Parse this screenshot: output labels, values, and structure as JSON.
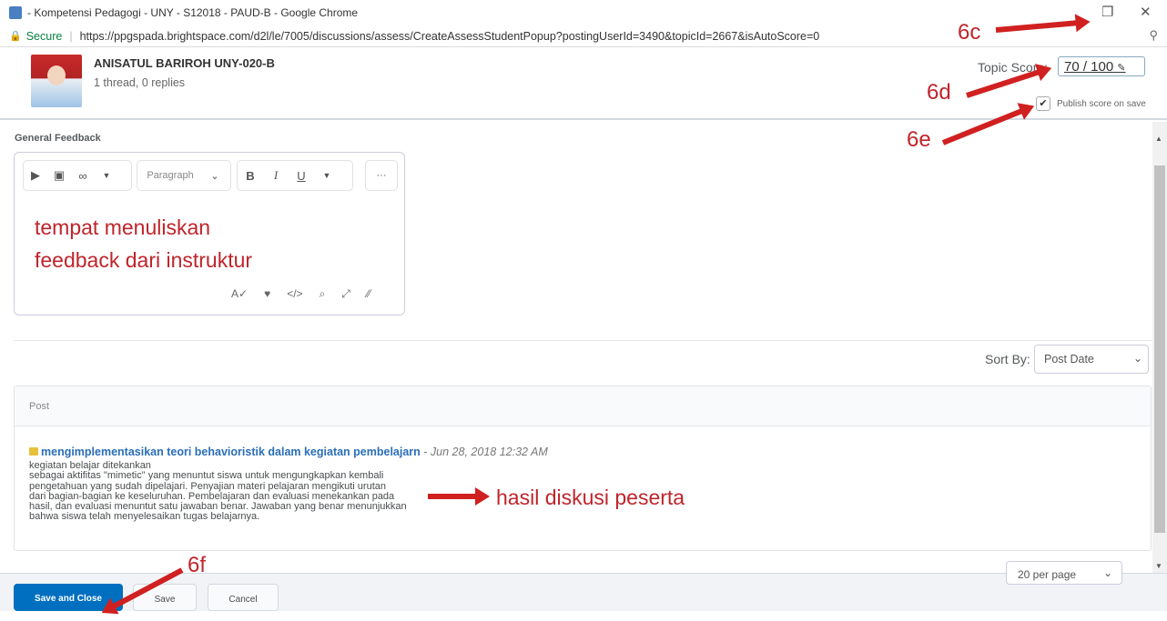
{
  "window": {
    "title": "- Kompetensi Pedagogi - UNY - S12018 - PAUD-B - Google Chrome",
    "restore_icon": "restore-icon",
    "close_icon": "close-icon"
  },
  "address_bar": {
    "secure_label": "Secure",
    "url": "https://ppgspada.brightspace.com/d2l/le/7005/discussions/assess/CreateAssessStudentPopup?postingUserId=3490&topicId=2667&isAutoScore=0"
  },
  "student": {
    "name": "ANISATUL BARIROH UNY-020-B",
    "threads": "1 thread, 0 replies"
  },
  "score": {
    "label": "Topic Score:",
    "value": "70 / 100",
    "publish_label": "Publish score on save",
    "publish_checked": true
  },
  "feedback": {
    "label": "General Feedback",
    "toolbar_paragraph": "Paragraph",
    "toolbar_bold": "B",
    "toolbar_italic": "I",
    "toolbar_underline": "U",
    "toolbar_more": "···",
    "editor_text_line1": "tempat menuliskan",
    "editor_text_line2": "feedback dari instruktur"
  },
  "sort": {
    "label": "Sort By:",
    "value": "Post Date"
  },
  "posts": {
    "header": "Post",
    "title": "mengimplementasikan teori behavioristik dalam kegiatan pembelajarn",
    "date": "- Jun 28, 2018 12:32 AM",
    "body_lines": [
      "kegiatan belajar ditekankan",
      "sebagai aktifitas \"mimetic\" yang menuntut siswa untuk mengungkapkan kembali",
      "pengetahuan yang sudah dipelajari. Penyajian materi pelajaran mengikuti urutan",
      "dari bagian-bagian ke keseluruhan. Pembelajaran dan evaluasi menekankan pada",
      "hasil, dan evaluasi menuntut satu jawaban benar. Jawaban yang benar menunjukkan",
      "bahwa siswa telah menyelesaikan tugas belajarnya."
    ]
  },
  "pagination": {
    "per_page": "20 per page"
  },
  "buttons": {
    "save_close": "Save and Close",
    "save": "Save",
    "cancel": "Cancel"
  },
  "annotations": {
    "a6c": "6c",
    "a6d": "6d",
    "a6e": "6e",
    "a6f": "6f",
    "hasil": "hasil diskusi peserta"
  }
}
